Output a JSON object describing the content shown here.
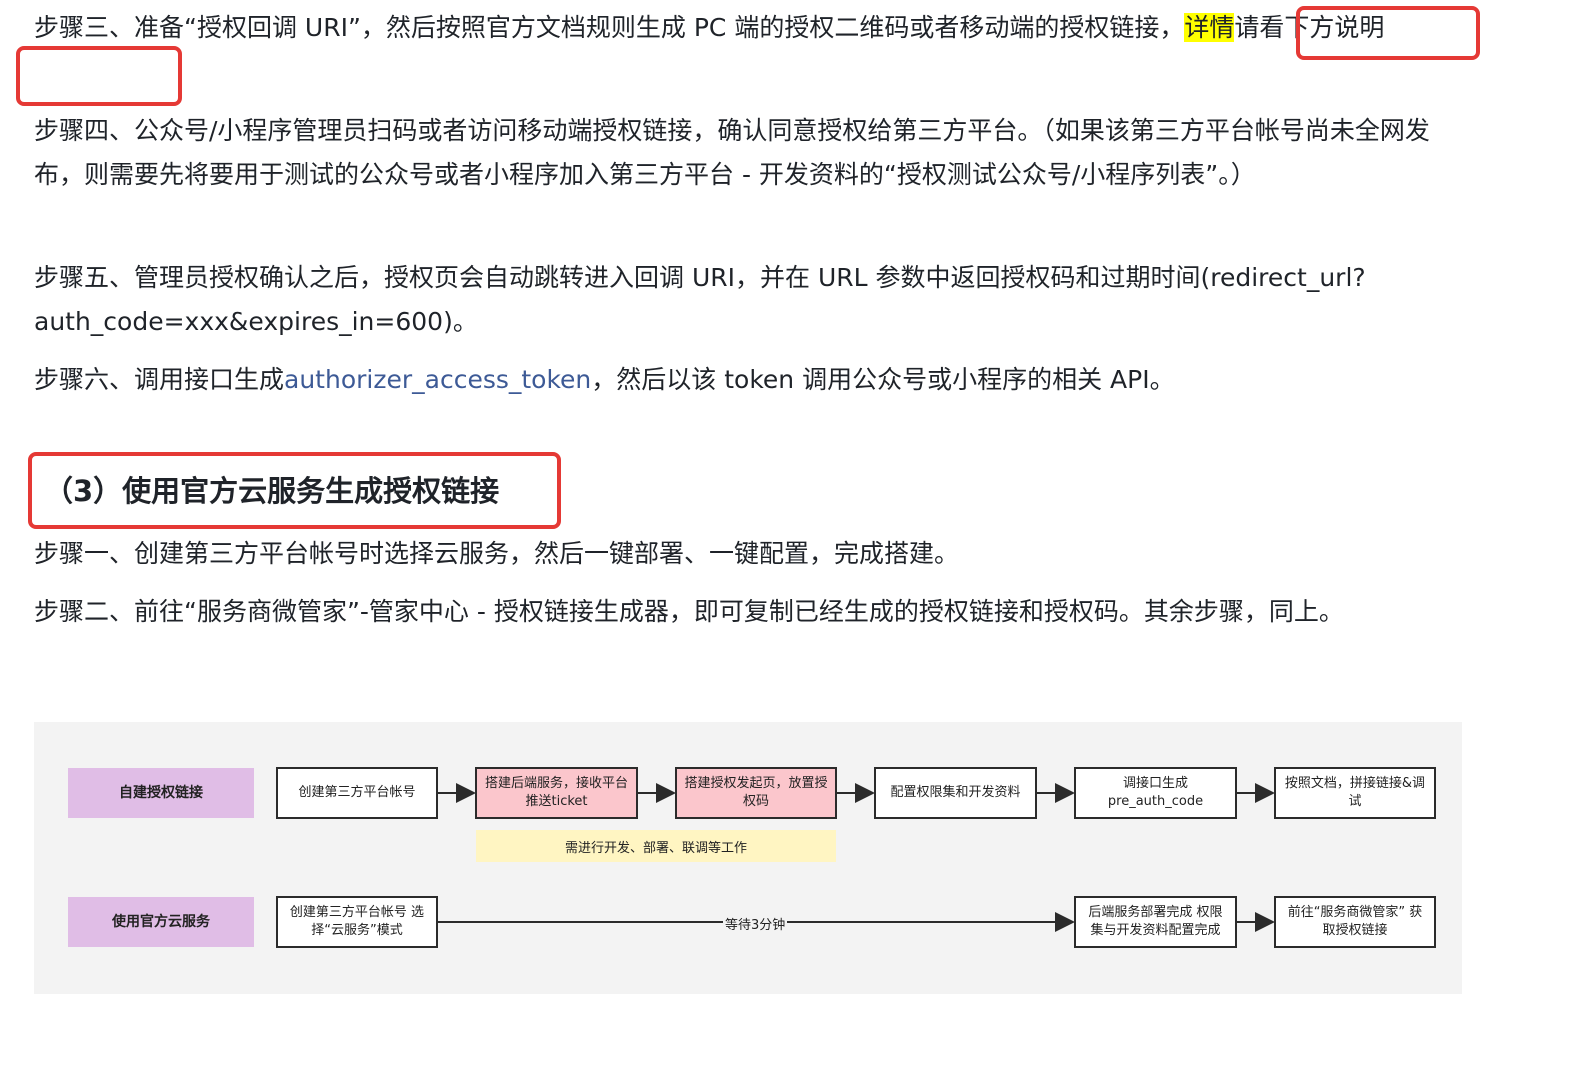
{
  "steps_top": {
    "step3_part1": "步骤三、准备“授权回调 URI”，然后按照官方文档规则生成 PC 端的授权二维码或者移动端的授权链接，",
    "step3_highlight": "详情",
    "step3_part2": "请看下方说明",
    "step4": "步骤四、公众号/小程序管理员扫码或者访问移动端授权链接，确认同意授权给第三方平台。（如果该第三方平台帐号尚未全网发布，则需要先将要用于测试的公众号或者小程序加入第三方平台 - 开发资料的“授权测试公众号/小程序列表”。）",
    "step5": "步骤五、管理员授权确认之后，授权页会自动跳转进入回调 URI，并在 URL 参数中返回授权码和过期时间(redirect_url?auth_code=xxx&expires_in=600)。",
    "step6_part1": "步骤六、调用接口生成",
    "step6_link": "authorizer_access_token",
    "step6_part2": "，然后以该 token 调用公众号或小程序的相关 API。"
  },
  "section3": {
    "heading": "（3）使用官方云服务生成授权链接",
    "step1": "步骤一、创建第三方平台帐号时选择云服务，然后一键部署、一键配置，完成搭建。",
    "step2": "步骤二、前往“服务商微管家”-管家中心 - 授权链接生成器，即可复制已经生成的授权链接和授权码。其余步骤，同上。"
  },
  "diagram": {
    "row1": {
      "label": "自建授权链接",
      "nodes": [
        "创建第三方平台帐号",
        "搭建后端服务，接收平台推送ticket",
        "搭建授权发起页，放置授权码",
        "配置权限集和开发资料",
        "调接口生成 pre_auth_code",
        "按照文档，拼接链接&调试"
      ],
      "note": "需进行开发、部署、联调等工作"
    },
    "row2": {
      "label": "使用官方云服务",
      "nodes": [
        "创建第三方平台帐号 选择“云服务”模式",
        "后端服务部署完成 权限集与开发资料配置完成",
        "前往“服务商微管家” 获取授权链接"
      ],
      "wait": "等待3分钟"
    }
  },
  "colors": {
    "highlight": "#ffff00",
    "annotation_red": "#e53935",
    "link": "#3d5a96",
    "label_purple": "#e0bde6",
    "pink_node": "#fbc6cc",
    "note_yellow": "#fff5c2"
  }
}
